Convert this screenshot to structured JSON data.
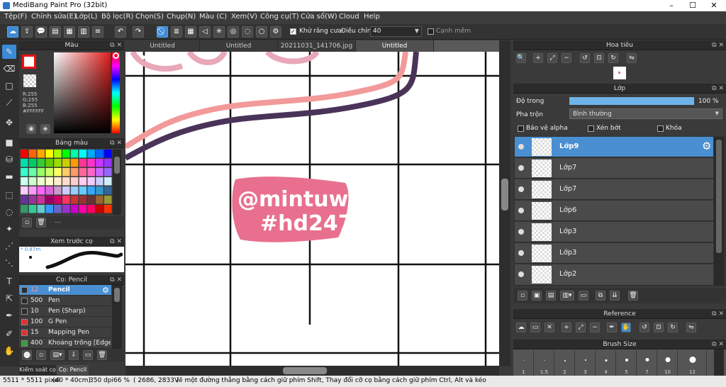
{
  "window": {
    "title": "MediBang Paint Pro (32bit)"
  },
  "menu": [
    "Tệp(F)",
    "Chỉnh sửa(E)",
    "Lớp(L)",
    "Bộ lọc(R)",
    "Chọn(S)",
    "Chụp(N)",
    "Màu (C)",
    "Xem(V)",
    "Công cụ(T)",
    "Cửa sổ(W)",
    "Cloud",
    "Help"
  ],
  "toolbar": {
    "antialias_label": "Khử răng cưa",
    "adjust_label": "Điều chỉnh",
    "adjust_value": "40",
    "sharp_label": "Cạnh mềm"
  },
  "tabs": [
    "Untitled",
    "Untitled",
    "20211031_141706.jpg",
    "Untitled"
  ],
  "color_panel": {
    "title": "Màu",
    "r": "R:255",
    "g": "G:255",
    "b": "B:255",
    "hex": "#FFFFFF"
  },
  "palette_panel": {
    "title": "Bảng màu",
    "footer": "---"
  },
  "brush_preview": {
    "title": "Xem trước cọ",
    "size": "0.87m"
  },
  "brush_panel": {
    "title": "Cọ: Pencil",
    "brushes": [
      {
        "size": "12",
        "name": "Pencil",
        "color": "#2b2b2b"
      },
      {
        "size": "500",
        "name": "Pen",
        "color": "#2b2b2b"
      },
      {
        "size": "10",
        "name": "Pen (Sharp)",
        "color": "#2b2b2b"
      },
      {
        "size": "100",
        "name": "G Pen",
        "color": "#e03030"
      },
      {
        "size": "15",
        "name": "Mapping Pen",
        "color": "#e03030"
      },
      {
        "size": "400",
        "name": "Khoảng trống [Edge",
        "color": "#3a9a3a"
      }
    ],
    "tab1": "Kiểm soát cọ",
    "tab2": "Cọ: Pencil"
  },
  "canvas_text": {
    "line1": "@mintuwu",
    "line2": "#hd247"
  },
  "navigator": {
    "title": "Hoa tiêu"
  },
  "layer_panel": {
    "title": "Lớp",
    "opacity_label": "Độ trong",
    "opacity_value": "100 %",
    "opacity": 1.0,
    "blend_label": "Pha trộn",
    "blend_value": "Bình thường",
    "protect_alpha": "Bảo vệ alpha",
    "clipping": "Xén bớt",
    "lock": "Khóa",
    "layers": [
      "Lớp9",
      "Lớp7",
      "Lớp7",
      "Lớp6",
      "Lớp3",
      "Lớp3",
      "Lớp2"
    ]
  },
  "reference": {
    "title": "Reference"
  },
  "brush_size": {
    "title": "Brush Size",
    "sizes": [
      "1",
      "1.5",
      "2",
      "3",
      "4",
      "5",
      "7",
      "10",
      "12"
    ]
  },
  "status": {
    "size": "5511 * 5511 pixel",
    "cm": "(40 * 40cm)",
    "dpi": "350 dpi",
    "zoom": "66 %",
    "coords": "( 2686, 2833 )",
    "hint": "Vẽ một đường thẳng bằng cách giữ phím Shift, Thay đổi cỡ cọ bằng cách giữ phím Ctrl, Alt và kéo"
  },
  "colors": {
    "accent": "#3c8bd7",
    "pink": "#e8708e",
    "purple": "#4a3358",
    "salmon": "#f29a9a"
  }
}
